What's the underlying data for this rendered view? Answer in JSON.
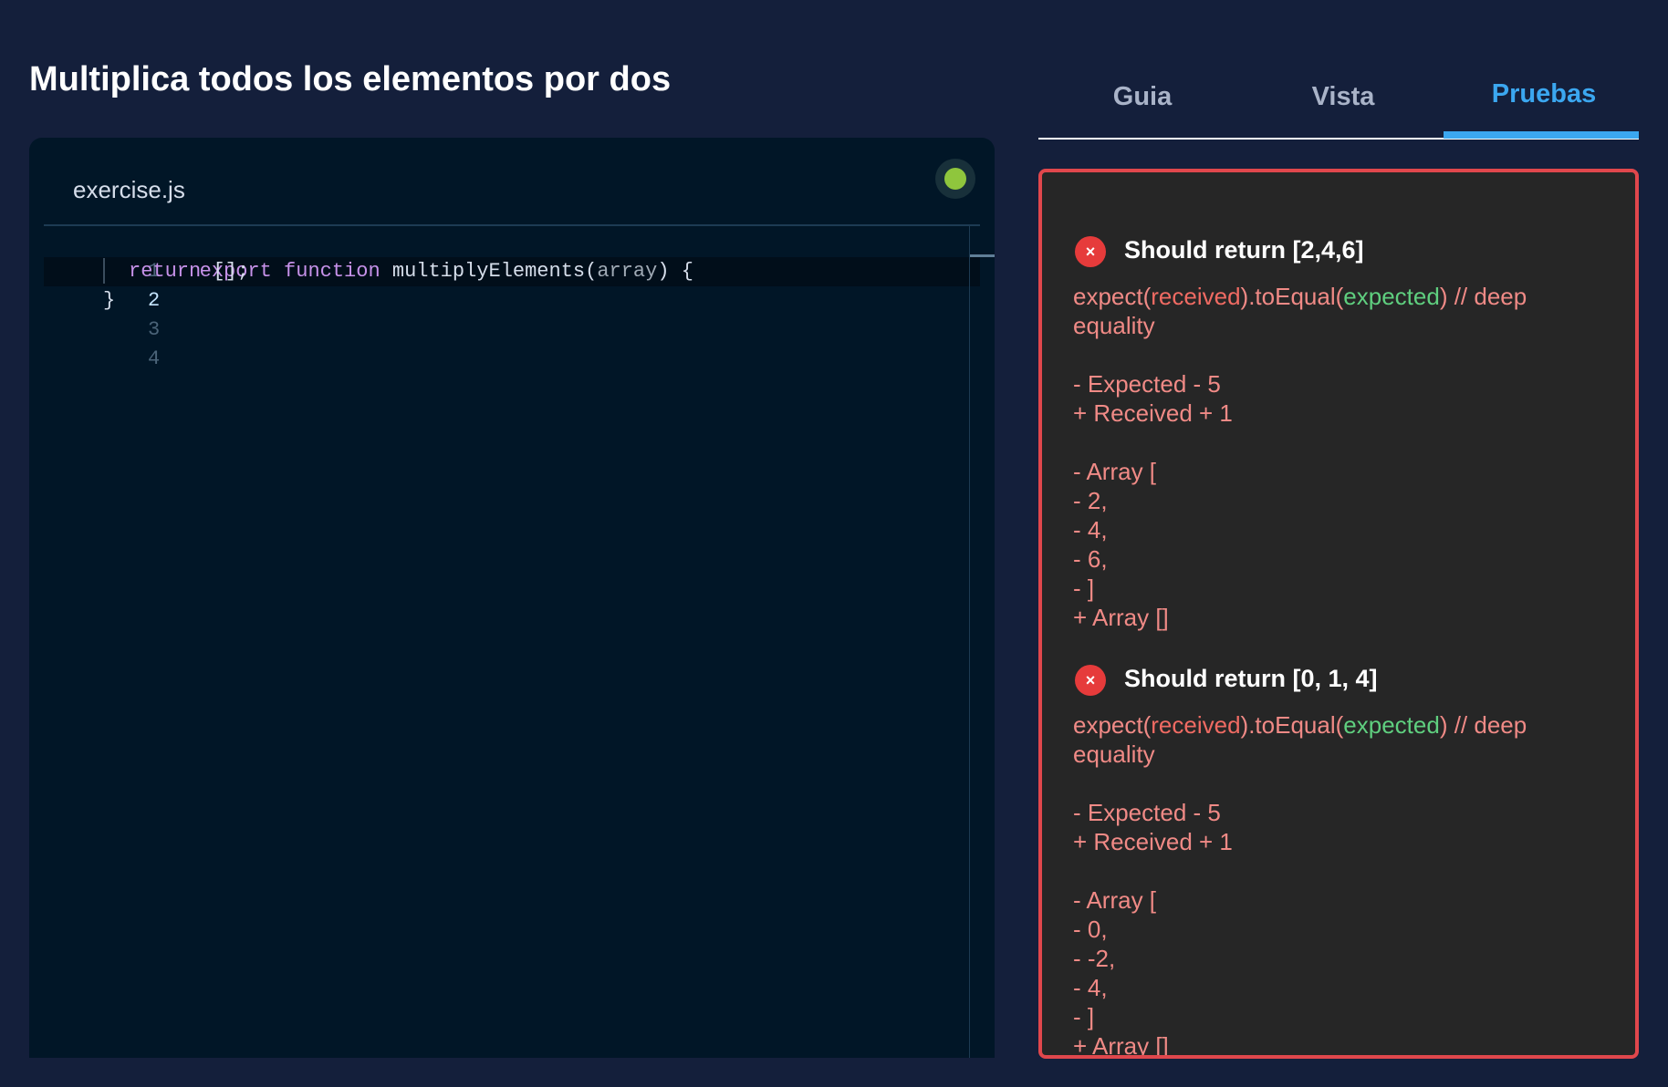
{
  "page": {
    "title": "Multiplica todos los elementos por dos"
  },
  "editor": {
    "filename": "exercise.js",
    "status_color": "#8fc63d",
    "lines": [
      {
        "number": "1",
        "tokens": [
          "export",
          "function",
          "multiplyElements(",
          "array",
          ") {"
        ]
      },
      {
        "number": "2",
        "tokens": [
          "return",
          "[];"
        ]
      },
      {
        "number": "3",
        "tokens": [
          "}"
        ]
      },
      {
        "number": "4",
        "tokens": []
      }
    ]
  },
  "tabs": [
    {
      "label": "Guia",
      "active": false
    },
    {
      "label": "Vista",
      "active": false
    },
    {
      "label": "Pruebas",
      "active": true
    }
  ],
  "tests": [
    {
      "title": "Should return [2,4,6]",
      "assert_prefix": "expect(",
      "assert_received": "received",
      "assert_middle": ").toEqual(",
      "assert_expected": "expected",
      "assert_suffix": ") // deep",
      "assert_wrap": "equality",
      "diff_header": [
        "- Expected - 5",
        "+ Received + 1"
      ],
      "diff_lines": [
        "- Array [",
        "- 2,",
        "- 4,",
        "- 6,",
        "- ]",
        "+ Array []"
      ]
    },
    {
      "title": "Should return [0, 1, 4]",
      "assert_prefix": "expect(",
      "assert_received": "received",
      "assert_middle": ").toEqual(",
      "assert_expected": "expected",
      "assert_suffix": ") // deep",
      "assert_wrap": "equality",
      "diff_header": [
        "- Expected - 5",
        "+ Received + 1"
      ],
      "diff_lines": [
        "- Array [",
        "- 0,",
        "- -2,",
        "- 4,",
        "- ]",
        "+ Array []"
      ]
    }
  ],
  "icons": {
    "fail": "×"
  },
  "colors": {
    "background": "#141f3b",
    "editor_bg": "#011627",
    "accent_tab": "#3ba7f0",
    "fail_border": "#e0474c",
    "fail_icon": "#e63b3b"
  }
}
